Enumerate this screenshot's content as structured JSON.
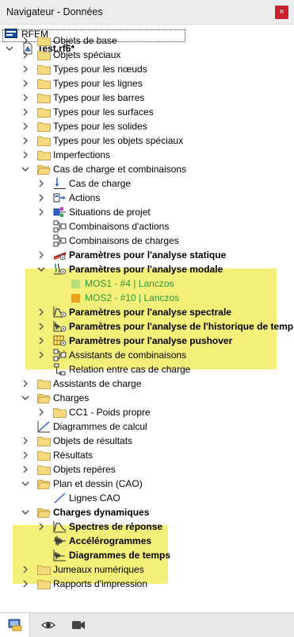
{
  "window": {
    "title": "Navigateur - Données",
    "close_label": "×"
  },
  "root": {
    "label": "RFEM"
  },
  "project": {
    "label": "Test.rf6*"
  },
  "tree": [
    {
      "label": "Objets de base"
    },
    {
      "label": "Objets spéciaux"
    },
    {
      "label": "Types pour les nœuds"
    },
    {
      "label": "Types pour les lignes"
    },
    {
      "label": "Types pour les barres"
    },
    {
      "label": "Types pour les surfaces"
    },
    {
      "label": "Types pour les solides"
    },
    {
      "label": "Types pour les objets spéciaux"
    },
    {
      "label": "Imperfections"
    },
    {
      "label": "Cas de charge et combinaisons"
    },
    {
      "label": "Cas de charge"
    },
    {
      "label": "Actions"
    },
    {
      "label": "Situations de projet"
    },
    {
      "label": "Combinaisons d'actions"
    },
    {
      "label": "Combinaisons de charges"
    },
    {
      "label": "Paramètres pour l'analyse statique"
    },
    {
      "label": "Paramètres pour l'analyse modale"
    },
    {
      "label": "MOS1 - #4 | Lanczos"
    },
    {
      "label": "MOS2 - #10 | Lanczos"
    },
    {
      "label": "Paramètres pour l'analyse spectrale"
    },
    {
      "label": "Paramètres pour l'analyse de l'historique de temps"
    },
    {
      "label": "Paramètres pour l'analyse pushover"
    },
    {
      "label": "Assistants de combinaisons"
    },
    {
      "label": "Relation entre cas de charge"
    },
    {
      "label": "Assistants de charge"
    },
    {
      "label": "Charges"
    },
    {
      "label": "CC1 - Poids propre"
    },
    {
      "label": "Diagrammes de calcul"
    },
    {
      "label": "Objets de résultats"
    },
    {
      "label": "Résultats"
    },
    {
      "label": "Objets repères"
    },
    {
      "label": "Plan et dessin (CAO)"
    },
    {
      "label": "Lignes CAO"
    },
    {
      "label": "Charges dynamiques"
    },
    {
      "label": "Spectres de réponse"
    },
    {
      "label": "Accélérogrammes"
    },
    {
      "label": "Diagrammes de temps"
    },
    {
      "label": "Jumeaux numériques"
    },
    {
      "label": "Rapports d'impression"
    }
  ],
  "colors": {
    "highlight": "#f3ef79",
    "green_text": "#2d9b3c",
    "folder": "#f5d97e",
    "close_button": "#c8222c",
    "mode1_swatch": "#b7e07a",
    "mode2_swatch": "#e8a21c"
  },
  "bottom_tabs": [
    {
      "icon": "data-navigator-icon",
      "active": true
    },
    {
      "icon": "eye-icon",
      "active": false
    },
    {
      "icon": "camera-icon",
      "active": false
    }
  ]
}
